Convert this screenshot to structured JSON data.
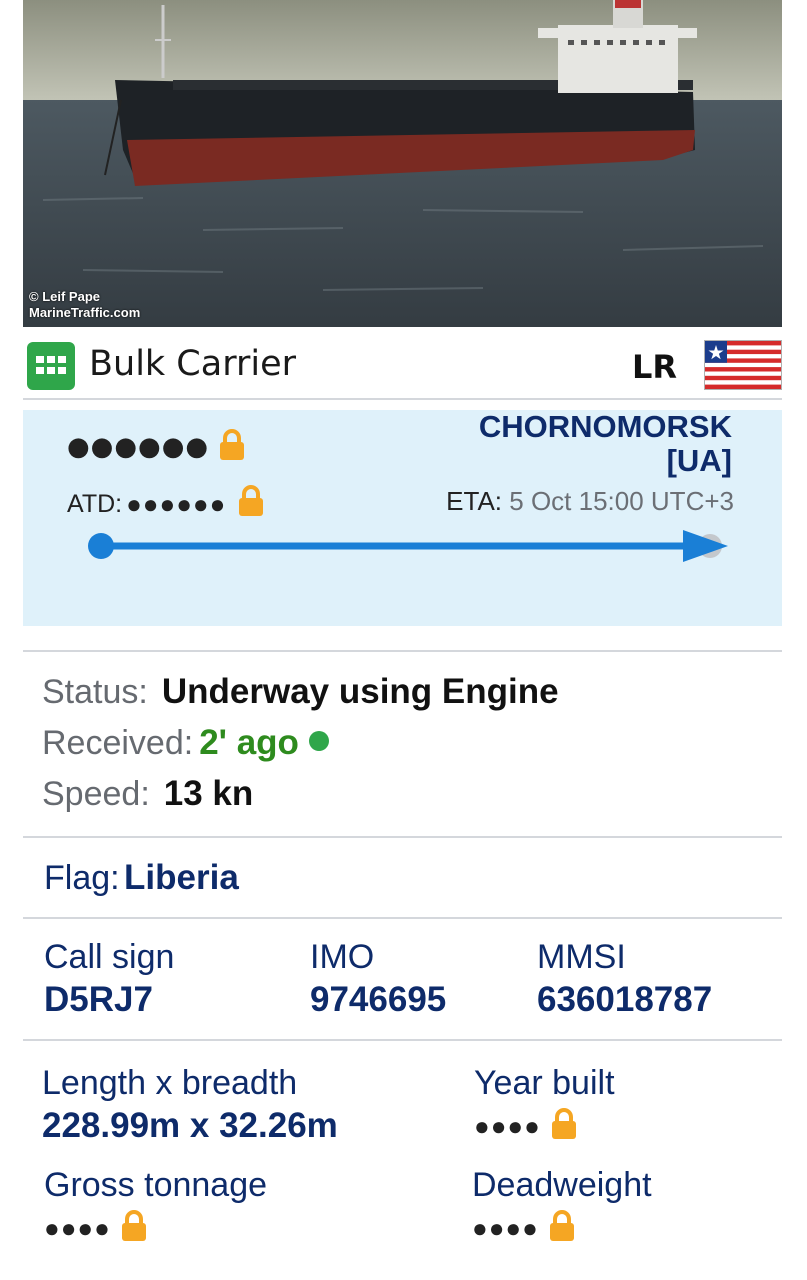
{
  "photo": {
    "credit_line1": "© Leif Pape",
    "credit_line2": "MarineTraffic.com"
  },
  "vessel_type": {
    "icon": "cargo-grid-icon",
    "label": "Bulk Carrier",
    "flag_code": "LR",
    "flag_icon": "liberia-flag-icon"
  },
  "voyage": {
    "departure_masked": "●●●●●●",
    "destination": "CHORNOMORSK",
    "destination_country": "[UA]",
    "atd_label": "ATD:",
    "atd_masked": "●●●●●●",
    "eta_label": "ETA:",
    "eta_value": "5 Oct 15:00 UTC+3",
    "progress_fraction": 1.0
  },
  "status": {
    "status_label": "Status:",
    "status_value": "Underway using Engine",
    "received_label": "Received:",
    "received_value": "2' ago",
    "speed_label": "Speed:",
    "speed_value": "13 kn"
  },
  "flag": {
    "label": "Flag:",
    "value": "Liberia"
  },
  "identifiers": {
    "callsign_label": "Call sign",
    "callsign_value": "D5RJ7",
    "imo_label": "IMO",
    "imo_value": "9746695",
    "mmsi_label": "MMSI",
    "mmsi_value": "636018787"
  },
  "dimensions": {
    "length_label": "Length x breadth",
    "length_value": "228.99m x 32.26m",
    "year_label": "Year built",
    "year_masked": "●●●●",
    "gross_label": "Gross tonnage",
    "gross_masked": "●●●●",
    "deadweight_label": "Deadweight",
    "deadweight_masked": "●●●●"
  },
  "colors": {
    "navy": "#0e2b6a",
    "route_blue": "#1a7fd6",
    "lock_orange": "#f5a623",
    "status_green": "#2e8b1e",
    "voyage_bg": "#dff1fa"
  }
}
